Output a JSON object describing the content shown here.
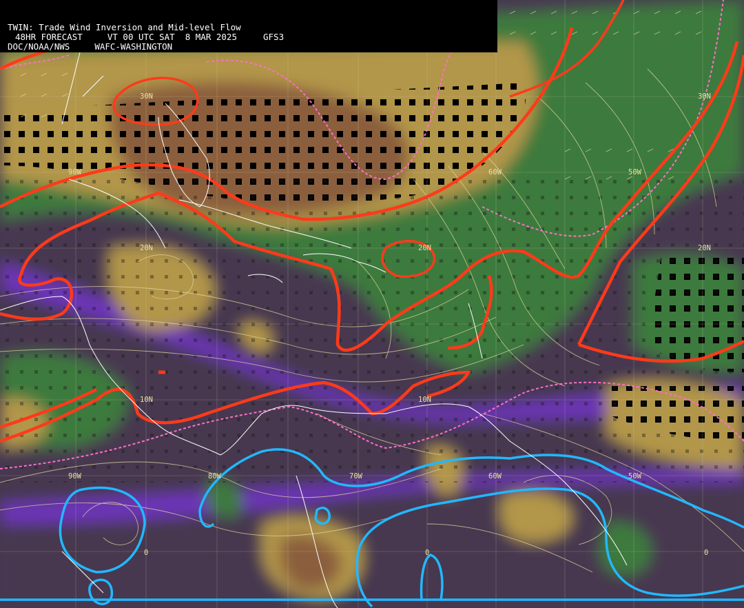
{
  "header": {
    "title": "TWIN: Trade Wind Inversion and Mid-level Flow",
    "forecast": "48HR FORECAST",
    "valid_time": "VT 00 UTC SAT  8 MAR 2025",
    "model": "GFS3",
    "agency": "DOC/NOAA/NWS",
    "center": "WAFC-WASHINGTON"
  },
  "grid_labels": {
    "lat_30n": "30N",
    "lat_20n": "20N",
    "lat_10n": "10N",
    "lat_0": "0",
    "lon_90w": "90W",
    "lon_80w": "80W",
    "lon_70w": "70W",
    "lon_60w": "60W",
    "lon_50w": "50W"
  },
  "colors": {
    "background_purple_gray": "#46394f",
    "green_field": "#3d7a3a",
    "light_green": "#5f9a45",
    "tan_field": "#b69a4a",
    "brown_field": "#8a5e3c",
    "purple_band": "#7a3fc4",
    "blue_band": "#55619c",
    "red_contour": "#ff3a1a",
    "pink_dashed": "#ff6ec7",
    "cyan_contour": "#22b8ff",
    "streamline": "#e4d9a0",
    "coastline": "#ffffff"
  }
}
